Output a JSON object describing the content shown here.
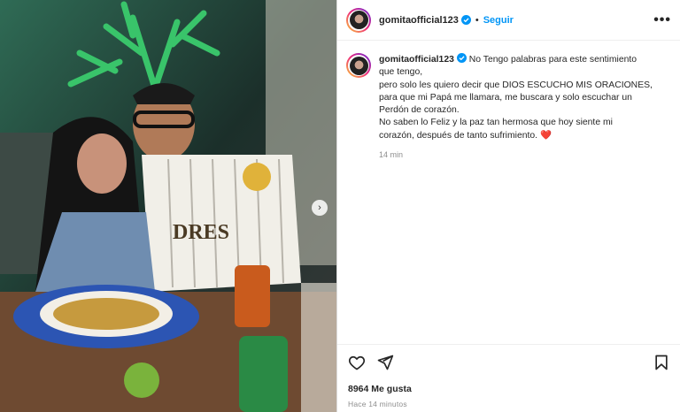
{
  "post": {
    "username": "gomitaofficial123",
    "follow_label": "Seguir",
    "separator": "•",
    "more_label": "•••",
    "next_label": "›"
  },
  "caption": {
    "username": "gomitaofficial123",
    "lines": [
      "No Tengo palabras para este sentimiento",
      "que tengo,",
      "pero solo les quiero decir que DIOS ESCUCHO MIS ORACIONES,",
      "para que mi Papá me llamara, me buscara y solo escuchar un",
      "Perdón de corazón.",
      "No saben lo Feliz y la paz tan hermosa que hoy siente mi",
      "corazón, después de tanto sufrimiento."
    ],
    "emoji": "❤️",
    "time": "14 min"
  },
  "footer": {
    "likes": "8964 Me gusta",
    "ago": "Hace 14 minutos"
  },
  "colors": {
    "accent": "#0095f6",
    "verified": "#0095f6",
    "text": "#262626",
    "muted": "#8e8e8e"
  },
  "icons": [
    "heart-icon",
    "send-icon",
    "bookmark-icon",
    "verified-badge-icon",
    "more-options-icon",
    "chevron-right-icon"
  ]
}
